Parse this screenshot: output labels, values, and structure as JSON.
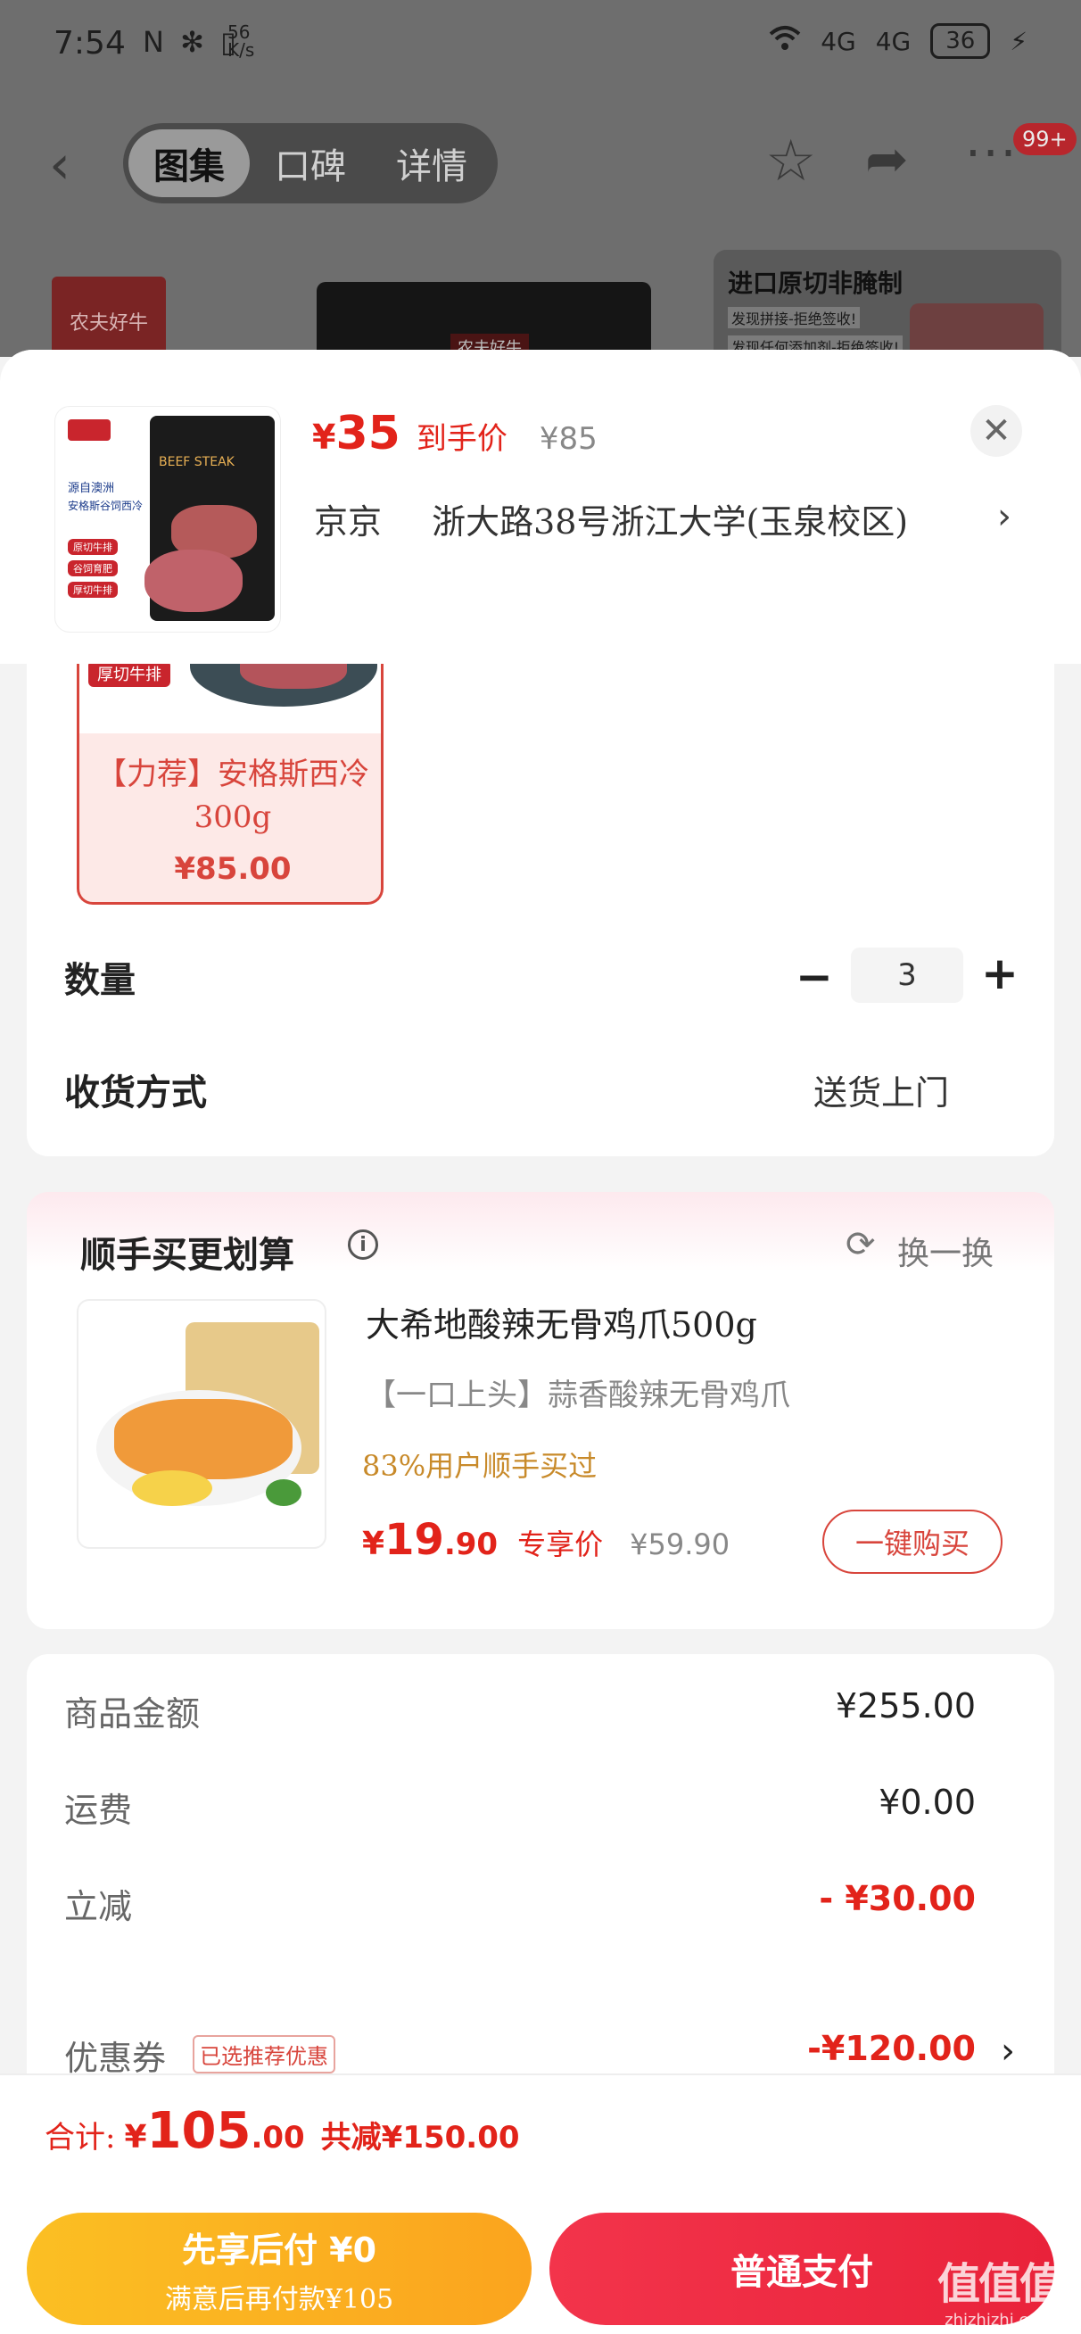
{
  "status_bar": {
    "time": "7:54",
    "icons": "N ✻ ▯",
    "net_speed": "56",
    "net_unit": "K/s",
    "signal_4g_1": "4G",
    "signal_4g_2": "4G",
    "battery": "36"
  },
  "nav": {
    "tabs": [
      {
        "label": "图集",
        "active": true
      },
      {
        "label": "口碑",
        "active": false
      },
      {
        "label": "详情",
        "active": false
      }
    ],
    "notification_badge": "99+"
  },
  "gallery": {
    "brand_logo_text": "农夫好牛",
    "card2_title": "进口原切非腌制",
    "card2_line1": "发现拼接-拒绝签收!",
    "card2_line2": "发现任何添加剂-拒绝签收!"
  },
  "sheet": {
    "price_symbol": "¥",
    "price": "35",
    "price_tag": "到手价",
    "original_price": "¥85",
    "address_name": "京京",
    "address": "浙大路38号浙江大学(玉泉校区)",
    "thumb": {
      "bag_title": "BEEF STEAK",
      "origin": "源自澳洲",
      "product": "安格斯谷饲西冷",
      "tags": [
        "原切牛排",
        "谷饲育肥",
        "厚切牛排"
      ]
    }
  },
  "variant": {
    "chip": "厚切牛排",
    "name": "【力荐】安格斯西冷300g",
    "price": "¥85.00"
  },
  "quantity": {
    "label": "数量",
    "value": "3"
  },
  "delivery": {
    "label": "收货方式",
    "value": "送货上门"
  },
  "recommend": {
    "title": "顺手买更划算",
    "refresh_label": "换一换",
    "product_name": "大希地酸辣无骨鸡爪500g",
    "subtitle": "【一口上头】蒜香酸辣无骨鸡爪",
    "social_proof": "83%用户顺手买过",
    "price_symbol": "¥",
    "price_int": "19",
    "price_dec": ".90",
    "price_tag": "专享价",
    "original_price": "¥59.90",
    "buy_label": "一键购买"
  },
  "summary": {
    "rows": [
      {
        "label": "商品金额",
        "value": "¥255.00"
      },
      {
        "label": "运费",
        "value": "¥0.00"
      },
      {
        "label": "立减",
        "value": "- ¥30.00"
      },
      {
        "label": "优惠券",
        "value": "-¥120.00"
      }
    ],
    "coupon_chip": "已选推荐优惠"
  },
  "footer": {
    "total_label": "合计:",
    "total_symbol": "¥",
    "total_int": "105",
    "total_dec": ".00",
    "total_discount": "共减¥150.00",
    "pay_later_title": "先享后付 ¥0",
    "pay_later_sub": "满意后再付款¥105",
    "pay_label": "普通支付"
  },
  "watermark": {
    "logo": "值值值",
    "url": "zhizhizhi.com"
  },
  "colors": {
    "accent_red": "#e2231a",
    "pay_later_yellow": "#fbbf23",
    "pay_red": "#f3344b"
  }
}
